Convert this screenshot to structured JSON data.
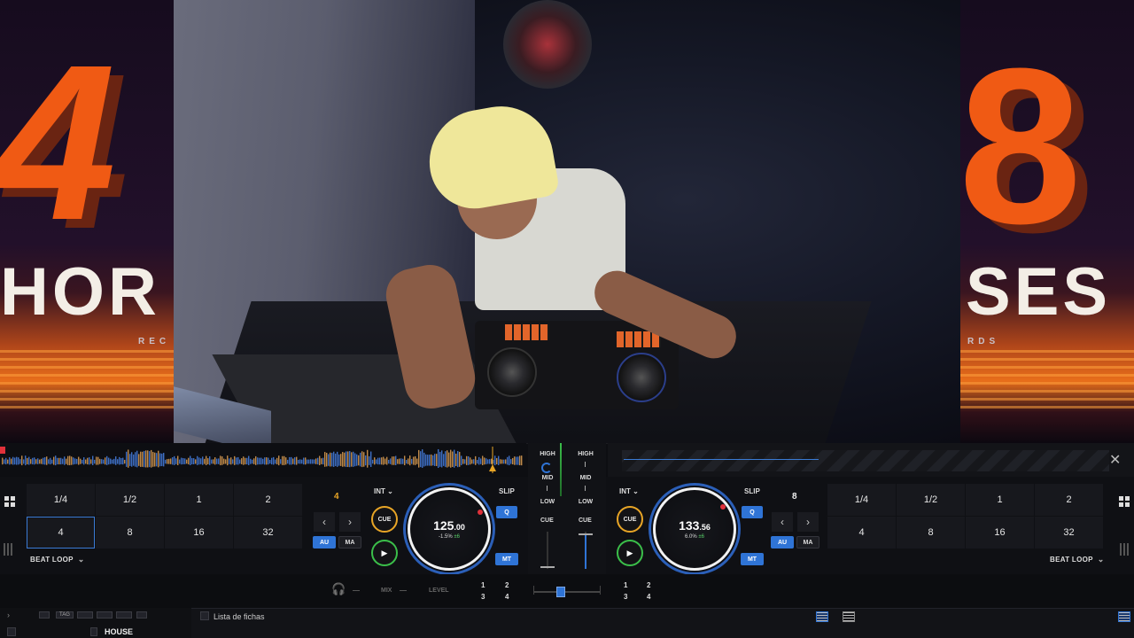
{
  "banner": {
    "left_number": "4",
    "left_word": "HOR",
    "left_small": "REC",
    "right_number": "8",
    "right_word": "SES",
    "right_small": "RDS"
  },
  "deck_left": {
    "pads_row1": [
      "1/4",
      "1/2",
      "1",
      "2"
    ],
    "pads_row2": [
      "4",
      "8",
      "16",
      "32"
    ],
    "selected_pad": "4",
    "loop_mode": "BEAT LOOP",
    "loop_size": "4",
    "int_label": "INT",
    "slip_label": "SLIP",
    "q_label": "Q",
    "au_label": "AU",
    "ma_label": "MA",
    "mt_label": "MT",
    "cue_label": "CUE",
    "play_symbol": "▶",
    "prev_symbol": "‹",
    "next_symbol": "›",
    "bpm_main": "125",
    "bpm_decimal": ".00",
    "pitch": "-1.5%",
    "pitch_range": "±6"
  },
  "deck_right": {
    "pads_row1": [
      "1/4",
      "1/2",
      "1",
      "2"
    ],
    "pads_row2": [
      "4",
      "8",
      "16",
      "32"
    ],
    "loop_mode": "BEAT LOOP",
    "loop_size": "8",
    "int_label": "INT",
    "slip_label": "SLIP",
    "q_label": "Q",
    "au_label": "AU",
    "ma_label": "MA",
    "mt_label": "MT",
    "cue_label": "CUE",
    "play_symbol": "▶",
    "prev_symbol": "‹",
    "next_symbol": "›",
    "bpm_main": "133",
    "bpm_decimal": ".56",
    "pitch": "6.0%",
    "pitch_range": "±6"
  },
  "mixer": {
    "high": "HIGH",
    "mid": "MID",
    "low": "LOW",
    "cue": "CUE"
  },
  "bottom": {
    "mix_label": "MIX",
    "level_label": "LEVEL",
    "left_nums": [
      "1",
      "2",
      "3",
      "4"
    ],
    "right_nums": [
      "1",
      "2",
      "3",
      "4"
    ]
  },
  "browser": {
    "tab_label": "TAG",
    "title": "Lista de fichas",
    "folder": "HOUSE"
  },
  "icons": {
    "close": "✕",
    "headphones": "🎧",
    "chevron": "⌄"
  },
  "colors": {
    "accent": "#2f74d6",
    "cue_ring": "#e8a526",
    "play_ring": "#3bbf4a",
    "banner_orange": "#f05a14"
  }
}
